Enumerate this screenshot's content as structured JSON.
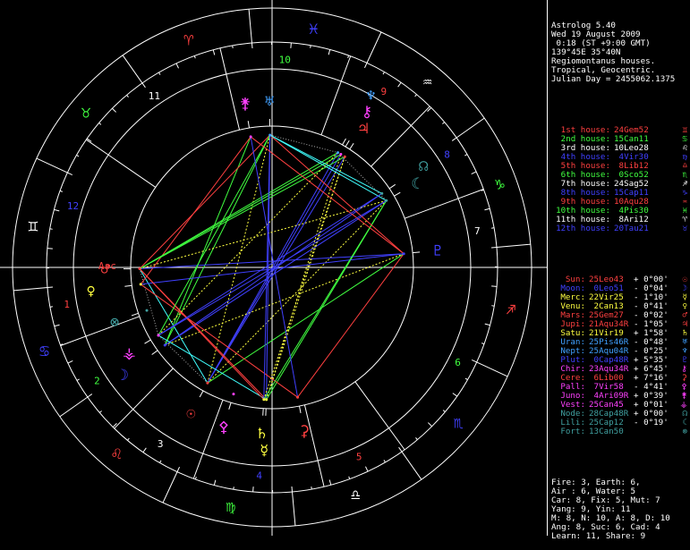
{
  "app": {
    "title": "Astrolog 5.40"
  },
  "header": [
    "Astrolog 5.40",
    "Wed 19 August 2009",
    " 0:18 (ST +9:00 GMT)",
    "139°45E 35°40N",
    "Regiomontanus houses.",
    "Tropical, Geocentric.",
    "Julian Day = 2455062.1375"
  ],
  "houses": [
    {
      "label": "1st house:",
      "pos": "24Gem52",
      "color": "#ff4040",
      "glyph": "♊"
    },
    {
      "label": "2nd house:",
      "pos": "15Can11",
      "color": "#40ff40",
      "glyph": "♋"
    },
    {
      "label": "3rd house:",
      "pos": "10Leo28",
      "color": "#ffffff",
      "glyph": "♌"
    },
    {
      "label": "4th house:",
      "pos": " 4Vir30",
      "color": "#4040ff",
      "glyph": "♍"
    },
    {
      "label": "5th house:",
      "pos": " 8Lib12",
      "color": "#ff4040",
      "glyph": "♎"
    },
    {
      "label": "6th house:",
      "pos": " 0Sco52",
      "color": "#40ff40",
      "glyph": "♏"
    },
    {
      "label": "7th house:",
      "pos": "24Sag52",
      "color": "#ffffff",
      "glyph": "♐"
    },
    {
      "label": "8th house:",
      "pos": "15Cap11",
      "color": "#4040ff",
      "glyph": "♑"
    },
    {
      "label": "9th house:",
      "pos": "10Aqu28",
      "color": "#ff4040",
      "glyph": "♒"
    },
    {
      "label": "10th house:",
      "pos": " 4Pis30",
      "color": "#40ff40",
      "glyph": "♓"
    },
    {
      "label": "11th house:",
      "pos": " 8Ari12",
      "color": "#ffffff",
      "glyph": "♈"
    },
    {
      "label": "12th house:",
      "pos": "20Tau21",
      "color": "#4040ff",
      "glyph": "♉"
    }
  ],
  "planets": [
    {
      "name": "Sun:",
      "pos": "25Leo43",
      "speed": "+ 0°00'",
      "color": "#ff4040",
      "glyph": "☉"
    },
    {
      "name": "Moon:",
      "pos": " 0Leo51",
      "speed": "- 0°04'",
      "color": "#4040ff",
      "glyph": "☽"
    },
    {
      "name": "Merc:",
      "pos": "22Vir25",
      "speed": "- 1°10'",
      "color": "#ffff40",
      "glyph": "☿"
    },
    {
      "name": "Venu:",
      "pos": " 2Can13",
      "speed": "- 0°41'",
      "color": "#ffff40",
      "glyph": "♀"
    },
    {
      "name": "Mars:",
      "pos": "25Gem27",
      "speed": "- 0°02'",
      "color": "#ff4040",
      "glyph": "♂"
    },
    {
      "name": "Jupi:",
      "pos": "21Aqu34R",
      "speed": "- 1°05'",
      "color": "#ff4040",
      "glyph": "♃"
    },
    {
      "name": "Satu:",
      "pos": "21Vir19",
      "speed": "+ 1°58'",
      "color": "#ffff40",
      "glyph": "♄"
    },
    {
      "name": "Uran:",
      "pos": "25Pis46R",
      "speed": "- 0°48'",
      "color": "#40a0ff",
      "glyph": "♅"
    },
    {
      "name": "Nept:",
      "pos": "25Aqu04R",
      "speed": "- 0°25'",
      "color": "#40a0ff",
      "glyph": "♆"
    },
    {
      "name": "Plut:",
      "pos": " 0Cap48R",
      "speed": "+ 5°35'",
      "color": "#4040ff",
      "glyph": "♇"
    },
    {
      "name": "Chir:",
      "pos": "23Aqu34R",
      "speed": "+ 6°45'",
      "color": "#ff40ff",
      "glyph": "⚷"
    },
    {
      "name": "Cere:",
      "pos": " 6Lib00",
      "speed": "+ 7°16'",
      "color": "#ff4040",
      "glyph": "⚳"
    },
    {
      "name": "Pall:",
      "pos": " 7Vir58",
      "speed": "- 4°41'",
      "color": "#ff40ff",
      "glyph": "⚴"
    },
    {
      "name": "Juno:",
      "pos": " 4Ari09R",
      "speed": "+ 0°39'",
      "color": "#ff40ff",
      "glyph": "⚵"
    },
    {
      "name": "Vest:",
      "pos": "25Can45",
      "speed": "+ 0°01'",
      "color": "#ff40ff",
      "glyph": "⚶"
    },
    {
      "name": "Node:",
      "pos": "28Cap48R",
      "speed": "+ 0°00'",
      "color": "#40a0a0",
      "glyph": "☊"
    },
    {
      "name": "Lili:",
      "pos": "25Cap12",
      "speed": "- 0°19'",
      "color": "#40a0a0",
      "glyph": "☾"
    },
    {
      "name": "Fort:",
      "pos": "13Can50",
      "speed": "",
      "color": "#40a0a0",
      "glyph": "⊗"
    }
  ],
  "stats": [
    "Fire: 3, Earth: 6,",
    "Air : 6, Water: 5",
    "Car: 8, Fix: 5, Mut: 7",
    "Yang: 9, Yin: 11",
    "M: 8, N: 10, A: 8, D: 10",
    "Ang: 8, Suc: 6, Cad: 4",
    "Learn: 11, Share: 9"
  ],
  "wheel": {
    "house_numbers": [
      "1",
      "2",
      "3",
      "4",
      "5",
      "6",
      "7",
      "8",
      "9",
      "10",
      "11",
      "12"
    ],
    "sign_glyphs": [
      "♈",
      "♉",
      "♊",
      "♋",
      "♌",
      "♍",
      "♎",
      "♏",
      "♐",
      "♑",
      "♒",
      "♓"
    ],
    "sign_colors": [
      "#ff4040",
      "#40ff40",
      "#ffffff",
      "#4040ff",
      "#ff4040",
      "#40ff40",
      "#ffffff",
      "#4040ff",
      "#ff4040",
      "#40ff40",
      "#ffffff",
      "#4040ff"
    ],
    "asc_label": "Asc",
    "ascendant_deg": 84.87,
    "house_cusps_deg": [
      84.87,
      105.18,
      130.47,
      154.5,
      188.2,
      210.87,
      264.87,
      285.18,
      310.47,
      334.5,
      8.2,
      50.35
    ],
    "bodies": [
      {
        "name": "Sun",
        "glyph": "☉",
        "lon": 145.72,
        "color": "#ff4040"
      },
      {
        "name": "Moon",
        "glyph": "☽",
        "lon": 120.85,
        "color": "#4040ff"
      },
      {
        "name": "Mercury",
        "glyph": "☿",
        "lon": 172.42,
        "color": "#ffff40"
      },
      {
        "name": "Venus",
        "glyph": "♀",
        "lon": 92.22,
        "color": "#ffff40"
      },
      {
        "name": "Mars",
        "glyph": "♂",
        "lon": 85.45,
        "color": "#ff4040"
      },
      {
        "name": "Jupiter",
        "glyph": "♃",
        "lon": 321.57,
        "color": "#ff4040"
      },
      {
        "name": "Saturn",
        "glyph": "♄",
        "lon": 171.32,
        "color": "#ffff40"
      },
      {
        "name": "Uranus",
        "glyph": "♅",
        "lon": 355.77,
        "color": "#40a0ff"
      },
      {
        "name": "Neptune",
        "glyph": "♆",
        "lon": 325.07,
        "color": "#40a0ff"
      },
      {
        "name": "Pluto",
        "glyph": "♇",
        "lon": 270.8,
        "color": "#4040ff"
      },
      {
        "name": "Chiron",
        "glyph": "⚷",
        "lon": 323.57,
        "color": "#ff40ff"
      },
      {
        "name": "Ceres",
        "glyph": "⚳",
        "lon": 186.0,
        "color": "#ff4040"
      },
      {
        "name": "Pallas",
        "glyph": "⚴",
        "lon": 157.97,
        "color": "#ff40ff"
      },
      {
        "name": "Juno",
        "glyph": "⚵",
        "lon": 4.15,
        "color": "#ff40ff"
      },
      {
        "name": "Vesta",
        "glyph": "⚶",
        "lon": 115.75,
        "color": "#ff40ff"
      },
      {
        "name": "Node",
        "glyph": "☊",
        "lon": 298.8,
        "color": "#40a0a0"
      },
      {
        "name": "Lilith",
        "glyph": "☾",
        "lon": 295.2,
        "color": "#40a0a0"
      },
      {
        "name": "Fortune",
        "glyph": "⊗",
        "lon": 103.83,
        "color": "#40a0a0"
      }
    ]
  }
}
